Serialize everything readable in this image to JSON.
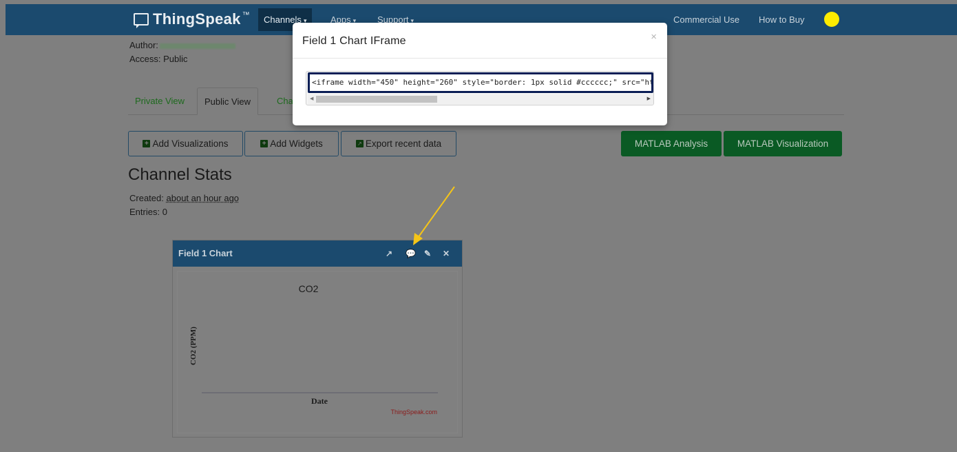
{
  "navbar": {
    "brand": "ThingSpeak",
    "trademark": "™",
    "items": [
      {
        "label": "Channels",
        "caret": "▾"
      },
      {
        "label": "Apps",
        "caret": "▾"
      },
      {
        "label": "Support",
        "caret": "▾"
      },
      {
        "label": "Commercial Use"
      },
      {
        "label": "How to Buy"
      }
    ],
    "avatar_color": "#ffec00"
  },
  "channel": {
    "author_label": "Author:",
    "access_label": "Access:",
    "access_value": "Public"
  },
  "tabs": [
    {
      "label": "Private View"
    },
    {
      "label": "Public View"
    },
    {
      "label": "Cha"
    }
  ],
  "actions": {
    "add_visualizations": "Add Visualizations",
    "add_widgets": "Add Widgets",
    "export_recent_data": "Export recent data",
    "matlab_analysis": "MATLAB Analysis",
    "matlab_visualization": "MATLAB Visualization"
  },
  "stats": {
    "title": "Channel Stats",
    "created_label": "Created:",
    "created_value": "about an hour ago",
    "entries_label": "Entries:",
    "entries_value": "0"
  },
  "chart_widget": {
    "title": "Field 1 Chart",
    "tool_icons": [
      "external-link-icon",
      "comment-icon",
      "pencil-icon",
      "close-icon"
    ],
    "chart_title": "CO2",
    "ylabel": "CO2 (PPM)",
    "xlabel": "Date",
    "credit": "ThingSpeak.com"
  },
  "chart_data": {
    "type": "line",
    "title": "CO2",
    "xlabel": "Date",
    "ylabel": "CO2 (PPM)",
    "series": [],
    "credit": "ThingSpeak.com"
  },
  "modal": {
    "title": "Field 1 Chart IFrame",
    "close": "×",
    "code": "<iframe width=\"450\" height=\"260\" style=\"border: 1px solid #cccccc;\" src=\"ht"
  },
  "colors": {
    "navbar": "#1b4a6e",
    "overlay_bg": "#7f7f7f",
    "green_button": "#0a5a24",
    "annotation_arrow": "#f5c518",
    "code_highlight": "#0a1e55"
  }
}
